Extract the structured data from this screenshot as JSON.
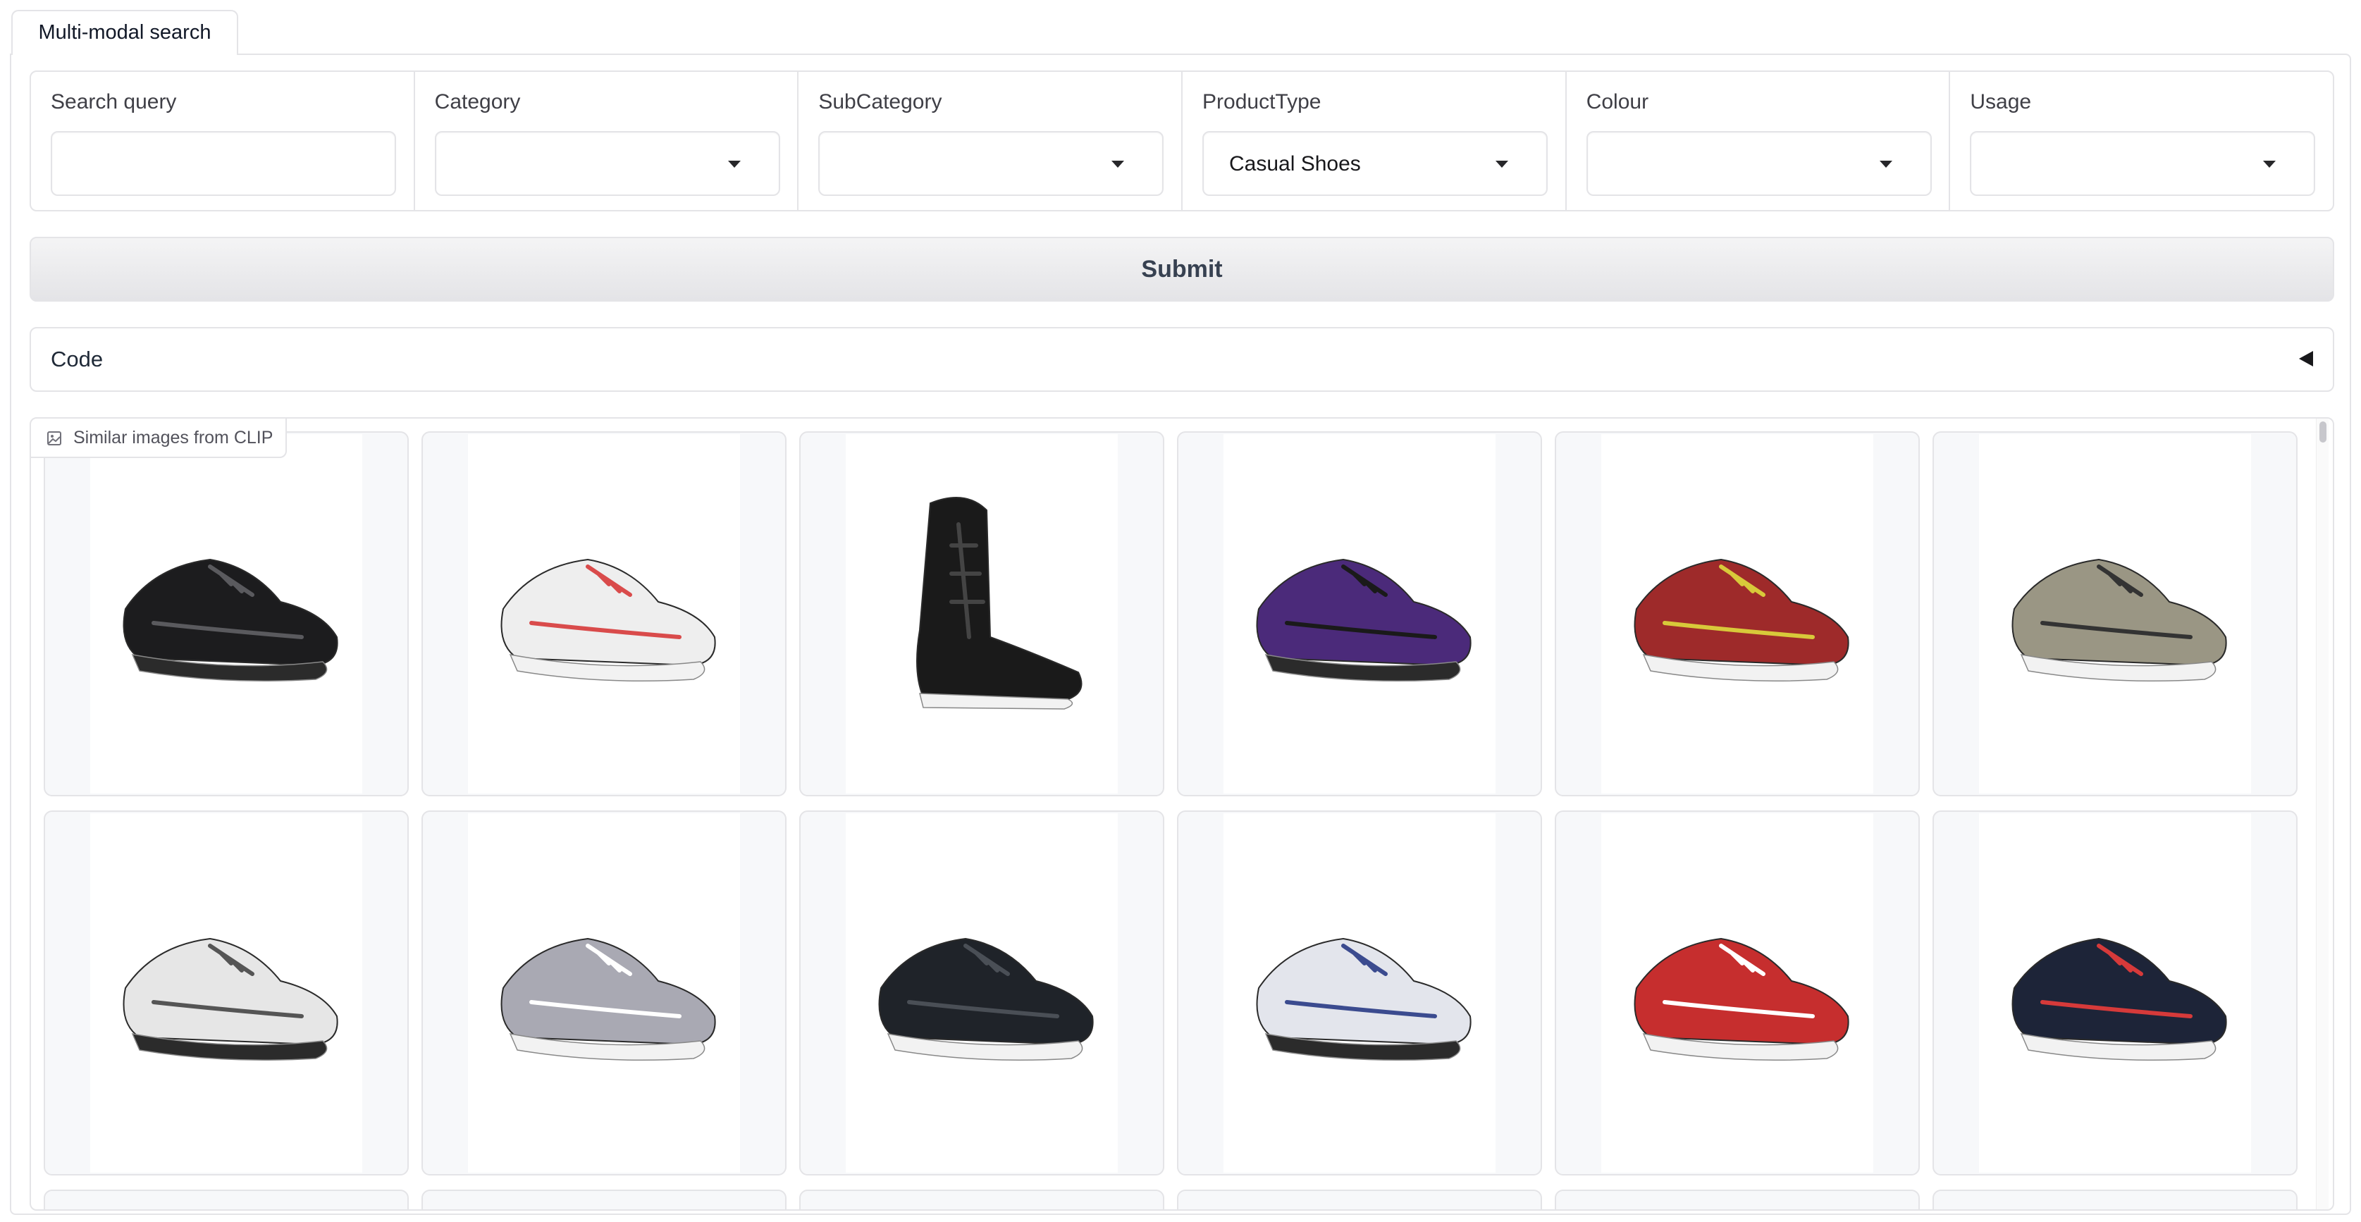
{
  "tabs": [
    {
      "label": "Multi-modal search"
    }
  ],
  "filters": {
    "search_query": {
      "label": "Search query",
      "value": ""
    },
    "category": {
      "label": "Category",
      "value": ""
    },
    "subcategory": {
      "label": "SubCategory",
      "value": ""
    },
    "product_type": {
      "label": "ProductType",
      "value": "Casual Shoes"
    },
    "colour": {
      "label": "Colour",
      "value": ""
    },
    "usage": {
      "label": "Usage",
      "value": ""
    }
  },
  "submit_label": "Submit",
  "code": {
    "label": "Code"
  },
  "gallery": {
    "label": "Similar images from CLIP",
    "items": [
      {
        "icon": "black-sneaker",
        "color": "#1c1c1e",
        "accent": "#5a5a5e"
      },
      {
        "icon": "white-red-sneaker",
        "color": "#eeeeee",
        "accent": "#d94b4b"
      },
      {
        "icon": "black-boot",
        "color": "#1a1a1a",
        "accent": "#444444"
      },
      {
        "icon": "purple-slip-on",
        "color": "#4b2a7a",
        "accent": "#1a1a1a"
      },
      {
        "icon": "red-lace-up",
        "color": "#9e2a2a",
        "accent": "#d8c93a"
      },
      {
        "icon": "grey-chukka",
        "color": "#9a9684",
        "accent": "#333333"
      },
      {
        "icon": "white-sandal-shoe",
        "color": "#e6e6e6",
        "accent": "#555555"
      },
      {
        "icon": "grey-canvas-sneaker",
        "color": "#a9a9b3",
        "accent": "#ffffff"
      },
      {
        "icon": "black-loafer",
        "color": "#1f2329",
        "accent": "#4a4f56"
      },
      {
        "icon": "white-blue-sneaker",
        "color": "#e3e5ec",
        "accent": "#3b4b8f"
      },
      {
        "icon": "red-velcro-sneaker",
        "color": "#c62e2e",
        "accent": "#ffffff"
      },
      {
        "icon": "navy-red-sneaker",
        "color": "#1d2438",
        "accent": "#d63a3a"
      }
    ]
  }
}
